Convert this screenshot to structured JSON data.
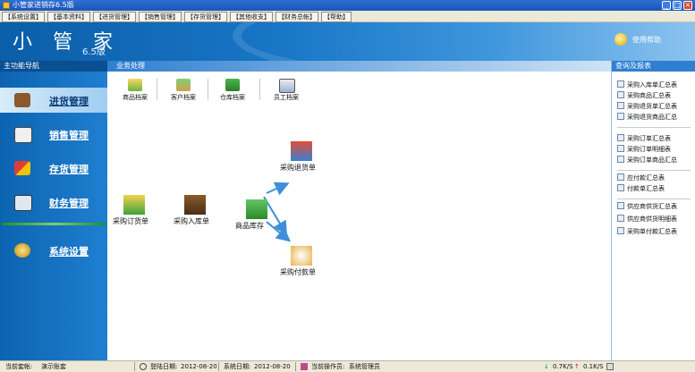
{
  "window": {
    "title": "小管家进销存6.5版"
  },
  "menu": [
    "【系统设置】",
    "【基本资料】",
    "【进货管理】",
    "【销售管理】",
    "【存货管理】",
    "【其他收支】",
    "【财务总帐】",
    "【帮助】"
  ],
  "banner": {
    "brand": "小 管 家",
    "version": "6.5版",
    "help_text": "使用帮助"
  },
  "left_nav": {
    "header": "主功能导航",
    "items": [
      {
        "label": "进货管理",
        "icon": "truck-icon",
        "active": true
      },
      {
        "label": "销售管理",
        "icon": "books-icon",
        "active": false
      },
      {
        "label": "存货管理",
        "icon": "boxes-icon",
        "active": false
      },
      {
        "label": "财务管理",
        "icon": "ledger-icon",
        "active": false
      },
      {
        "label": "系统设置",
        "icon": "settings-icon",
        "active": false
      }
    ]
  },
  "center": {
    "header": "业务处理",
    "toolbar": [
      {
        "label": "商品档案",
        "icon": "product-icon"
      },
      {
        "label": "客户档案",
        "icon": "customer-icon"
      },
      {
        "label": "仓库档案",
        "icon": "warehouse-icon"
      },
      {
        "label": "员工档案",
        "icon": "employee-icon"
      }
    ],
    "flow": {
      "purchase_order": "采购订货单",
      "purchase_receipt": "采购入库单",
      "inventory": "商品库存",
      "purchase_return": "采购退货单",
      "purchase_payment": "采购付款单"
    }
  },
  "right_panel": {
    "header": "查询及报表",
    "groups": [
      [
        "采购入库单汇总表",
        "采购商品汇总表",
        "采购退货单汇总表",
        "采购退货商品汇总"
      ],
      [
        "采购订单汇总表",
        "采购订单明细表",
        "采购订单商品汇总"
      ],
      [
        "应付款汇总表",
        "付款单汇总表"
      ],
      [
        "供应商供货汇总表",
        "供应商供货明细表",
        "采购单付款汇总表"
      ]
    ]
  },
  "status": {
    "account_label": "当前套帐:",
    "account_value": "演示账套",
    "login_date_label": "登陆日期:",
    "login_date": "2012-08-20",
    "system_date_label": "系统日期:",
    "system_date": "2012-08-20",
    "operator_label": "当前操作员:",
    "operator": "系统管理员",
    "down_speed": "0.7K/S",
    "up_speed": "0.1K/S"
  },
  "colors": {
    "accent": "#1876c6",
    "nav": "#1f7fd0",
    "active_nav": "#d8ecfb"
  }
}
